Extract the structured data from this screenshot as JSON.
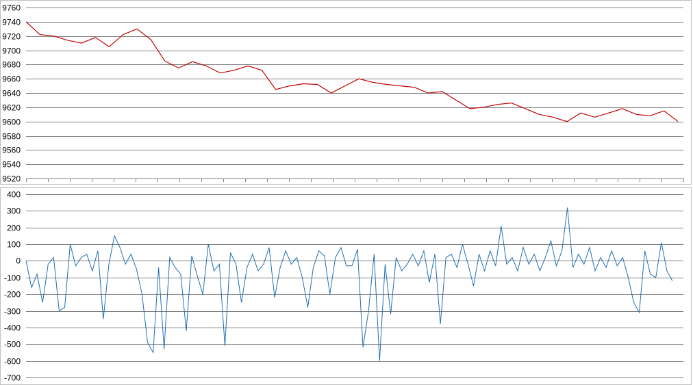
{
  "chart_data": [
    {
      "type": "line",
      "title": "",
      "xlabel": "",
      "ylabel": "",
      "ylim": [
        9520,
        9760
      ],
      "yticks": [
        "9760",
        "9740",
        "9720",
        "9700",
        "9680",
        "9660",
        "9640",
        "9620",
        "9600",
        "9580",
        "9560",
        "9540",
        "9520"
      ],
      "grid": true,
      "legend": "none",
      "color": "#c00000",
      "x": [
        0,
        20,
        40,
        60,
        80,
        100,
        120,
        140,
        160,
        180,
        200,
        220,
        240,
        260,
        280,
        300,
        320,
        340,
        360,
        380,
        400,
        420,
        440,
        460,
        480,
        500,
        520,
        540,
        560,
        580,
        600,
        620,
        640,
        660,
        680,
        700,
        720,
        740,
        760,
        780,
        800,
        820,
        840,
        860,
        880,
        900,
        920,
        940
      ],
      "series": [
        {
          "values": [
            9740,
            9722,
            9720,
            9714,
            9710,
            9718,
            9705,
            9722,
            9730,
            9715,
            9685,
            9675,
            9684,
            9678,
            9668,
            9672,
            9678,
            9672,
            9645,
            9650,
            9653,
            9652,
            9640,
            9650,
            9660,
            9655,
            9652,
            9650,
            9648,
            9640,
            9642,
            9630,
            9618,
            9620,
            9624,
            9626,
            9618,
            9610,
            9606,
            9600,
            9612,
            9606,
            9612,
            9618,
            9610,
            9608,
            9615,
            9600
          ]
        }
      ]
    },
    {
      "type": "line",
      "title": "",
      "xlabel": "",
      "ylabel": "",
      "ylim": [
        -700,
        400
      ],
      "yticks": [
        "400",
        "300",
        "200",
        "100",
        "0",
        "-100",
        "-200",
        "-300",
        "-400",
        "-500",
        "-600",
        "-700"
      ],
      "grid": true,
      "legend": "none",
      "color": "#1f6fb4",
      "x": [
        0,
        8,
        16,
        24,
        32,
        40,
        48,
        56,
        64,
        72,
        80,
        88,
        96,
        104,
        112,
        120,
        128,
        136,
        144,
        152,
        160,
        168,
        176,
        184,
        192,
        200,
        208,
        216,
        224,
        232,
        240,
        248,
        256,
        264,
        272,
        280,
        288,
        296,
        304,
        312,
        320,
        328,
        336,
        344,
        352,
        360,
        368,
        376,
        384,
        392,
        400,
        408,
        416,
        424,
        432,
        440,
        448,
        456,
        464,
        472,
        480,
        488,
        496,
        504,
        512,
        520,
        528,
        536,
        544,
        552,
        560,
        568,
        576,
        584,
        592,
        600,
        608,
        616,
        624,
        632,
        640,
        648,
        656,
        664,
        672,
        680,
        688,
        696,
        704,
        712,
        720,
        728,
        736,
        744,
        752,
        760,
        768,
        776,
        784,
        792,
        800,
        808,
        816,
        824,
        832,
        840,
        848,
        856,
        864,
        872,
        880,
        888,
        896,
        904,
        912,
        920,
        928,
        936,
        944
      ],
      "series": [
        {
          "values": [
            0,
            -160,
            -80,
            -250,
            -20,
            20,
            -300,
            -280,
            100,
            -30,
            20,
            40,
            -60,
            60,
            -350,
            -20,
            150,
            80,
            -20,
            40,
            -50,
            -200,
            -490,
            -550,
            -40,
            -530,
            20,
            -40,
            -80,
            -420,
            30,
            -90,
            -200,
            100,
            -60,
            -20,
            -510,
            50,
            -20,
            -250,
            -40,
            40,
            -60,
            -20,
            80,
            -220,
            -40,
            60,
            -20,
            20,
            -100,
            -280,
            -40,
            60,
            30,
            -200,
            20,
            80,
            -30,
            -30,
            70,
            -520,
            -300,
            40,
            -600,
            -20,
            -320,
            20,
            -60,
            -20,
            40,
            -30,
            60,
            -130,
            40,
            -380,
            20,
            40,
            -40,
            100,
            -20,
            -150,
            40,
            -60,
            60,
            -30,
            210,
            -20,
            20,
            -60,
            80,
            -20,
            40,
            -60,
            20,
            120,
            -30,
            60,
            320,
            -40,
            40,
            -20,
            80,
            -60,
            20,
            -40,
            60,
            -30,
            20,
            -100,
            -250,
            -310,
            60,
            -80,
            -100,
            110,
            -60,
            -120
          ]
        }
      ]
    }
  ]
}
